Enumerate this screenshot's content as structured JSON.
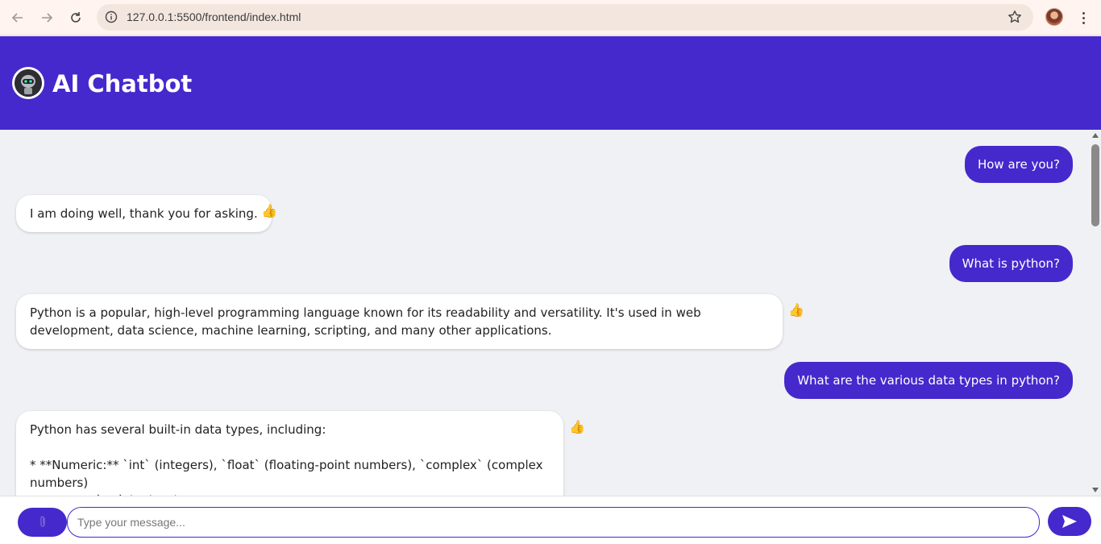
{
  "browser": {
    "url": "127.0.0.1:5500/frontend/index.html"
  },
  "app": {
    "title": "AI Chatbot"
  },
  "messages": [
    {
      "role": "user",
      "text": "How are you?"
    },
    {
      "role": "bot",
      "text": "I am doing well, thank you for asking."
    },
    {
      "role": "user",
      "text": "What is python?"
    },
    {
      "role": "bot",
      "text": "Python is a popular, high-level programming language known for its readability and versatility. It's used in web development, data science, machine learning, scripting, and many other applications."
    },
    {
      "role": "user",
      "text": "What are the various data types in python?"
    },
    {
      "role": "bot",
      "text": "Python has several built-in data types, including:\n\n* **Numeric:** `int` (integers), `float` (floating-point numbers), `complex` (complex numbers)\n* **Text:** `str` (strings)"
    }
  ],
  "composer": {
    "placeholder": "Type your message...",
    "attach_icon": "paperclip-icon",
    "send_icon": "send-icon"
  },
  "colors": {
    "accent": "#4529cc",
    "background": "#f0f1f5"
  }
}
